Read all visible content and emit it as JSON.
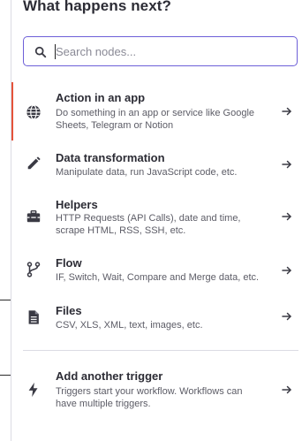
{
  "header": {
    "title": "What happens next?"
  },
  "search": {
    "placeholder": "Search nodes...",
    "value": ""
  },
  "items": [
    {
      "label": "Action in an app",
      "description": "Do something in an app or service like Google Sheets, Telegram or Notion",
      "icon": "globe-icon"
    },
    {
      "label": "Data transformation",
      "description": "Manipulate data, run JavaScript code, etc.",
      "icon": "pencil-icon"
    },
    {
      "label": "Helpers",
      "description": "HTTP Requests (API Calls), date and time, scrape HTML, RSS, SSH, etc.",
      "icon": "toolbox-icon"
    },
    {
      "label": "Flow",
      "description": "IF, Switch, Wait, Compare and Merge data, etc.",
      "icon": "branch-icon"
    },
    {
      "label": "Files",
      "description": "CSV, XLS, XML, text, images, etc.",
      "icon": "file-icon"
    },
    {
      "label": "Add another trigger",
      "description": "Triggers start your workflow. Workflows can have multiple triggers.",
      "icon": "bolt-icon"
    }
  ],
  "colors": {
    "accent": "#6d5fd8",
    "active_indicator": "#e5533b"
  }
}
